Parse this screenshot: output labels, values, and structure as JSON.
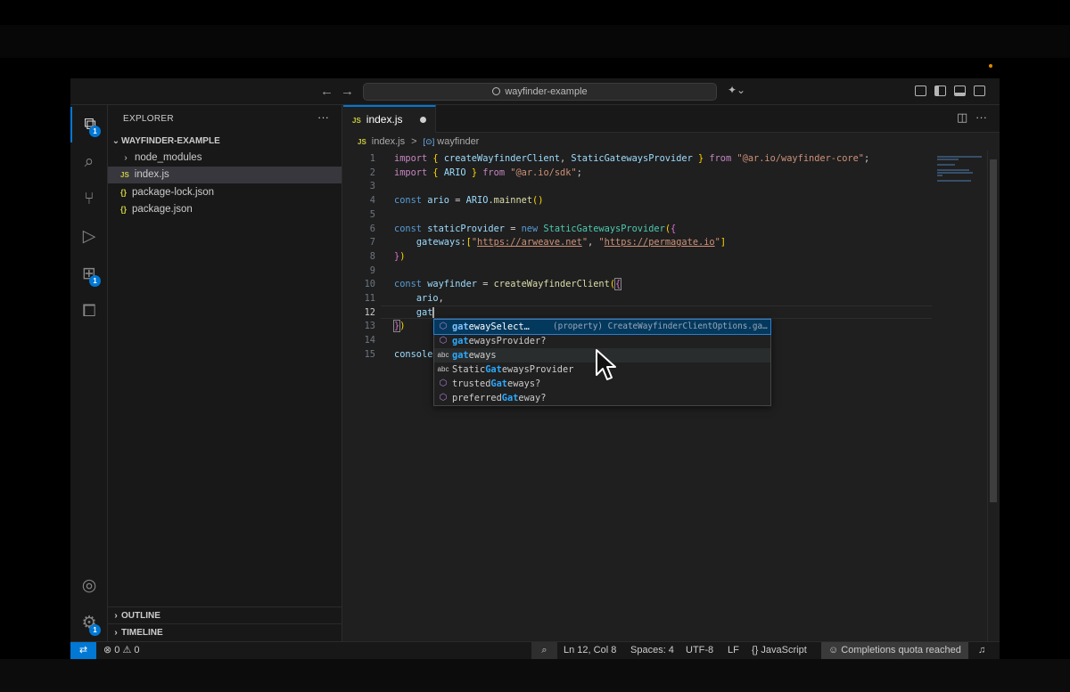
{
  "titlebar": {
    "back_icon": "←",
    "forward_icon": "→",
    "search_text": "wayfinder-example"
  },
  "activity_badges": {
    "explorer": "1",
    "extensions": "1",
    "settings": "1"
  },
  "sidebar": {
    "title": "EXPLORER",
    "more": "···",
    "folder": "WAYFINDER-EXAMPLE",
    "items": [
      {
        "label": "node_modules",
        "kind": "folder"
      },
      {
        "label": "index.js",
        "kind": "js"
      },
      {
        "label": "package-lock.json",
        "kind": "json"
      },
      {
        "label": "package.json",
        "kind": "json"
      }
    ],
    "outline": "OUTLINE",
    "timeline": "TIMELINE"
  },
  "tabs": [
    {
      "label": "index.js",
      "badge": "JS"
    }
  ],
  "breadcrumb": {
    "file": "index.js",
    "separator": ">",
    "symbol": "wayfinder"
  },
  "editor": {
    "line_numbers": [
      "1",
      "2",
      "3",
      "4",
      "5",
      "6",
      "7",
      "8",
      "9",
      "10",
      "11",
      "12",
      "13",
      "14",
      "15"
    ],
    "current_line": 12
  },
  "suggestions": [
    {
      "icon": "property-icon",
      "label": "gatewaySelect…",
      "detail": "(property) CreateWayfinderClientOptions.ga…",
      "selected": true
    },
    {
      "icon": "property-icon",
      "label": "gatewaysProvider?",
      "detail": ""
    },
    {
      "icon": "text-icon",
      "label": "gateways",
      "detail": ""
    },
    {
      "icon": "text-icon",
      "label": "StaticGatewaysProvider",
      "detail": ""
    },
    {
      "icon": "property-icon",
      "label": "trustedGateways?",
      "detail": ""
    },
    {
      "icon": "property-icon",
      "label": "preferredGateway?",
      "detail": ""
    }
  ],
  "statusbar": {
    "errors": "0",
    "warnings": "0",
    "position": "Ln 12, Col 8",
    "spaces": "Spaces: 4",
    "encoding": "UTF-8",
    "eol": "LF",
    "language": "JavaScript",
    "quota": "Completions quota reached"
  },
  "colors": {
    "accent": "#0078d4",
    "keyword": "#569cd6",
    "string": "#ce9178",
    "function": "#dcdcaa",
    "class": "#4ec9b0"
  }
}
